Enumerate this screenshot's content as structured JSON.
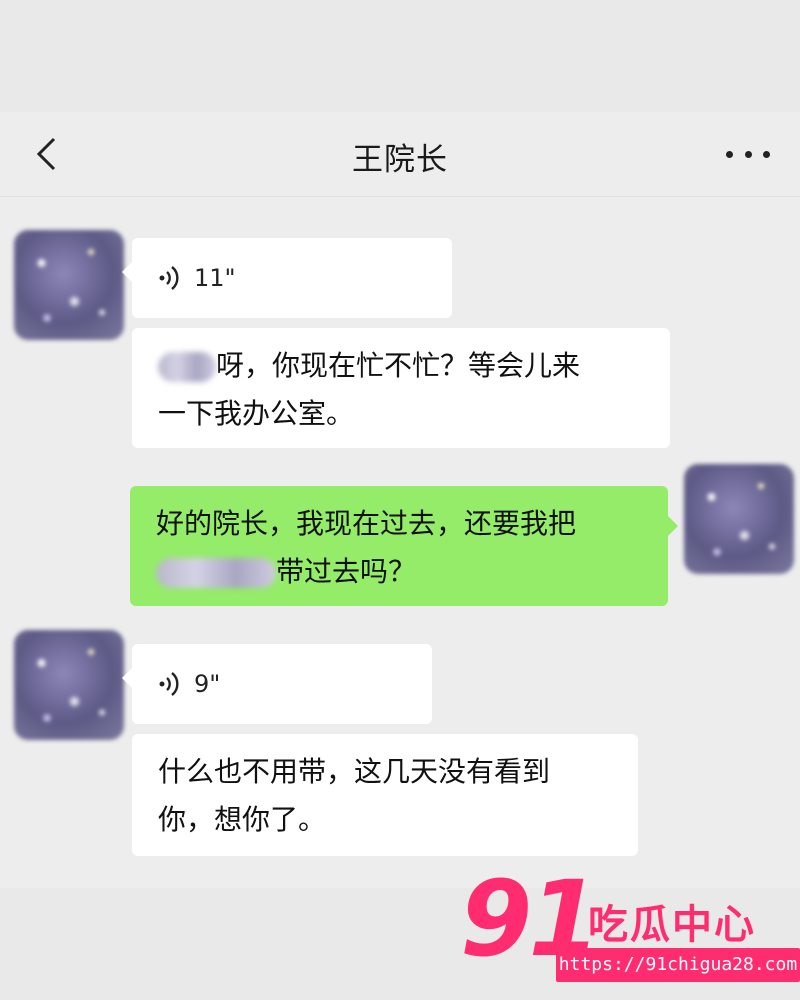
{
  "header": {
    "title": "王院长",
    "back_icon": "chevron-left-icon",
    "more_icon": "ellipsis-icon"
  },
  "messages": [
    {
      "side": "in",
      "type": "voice",
      "duration": "11\""
    },
    {
      "side": "in",
      "type": "text",
      "line1_visible": "呀，你现在忙不忙？等会儿来",
      "line2": "一下我办公室。"
    },
    {
      "side": "out",
      "type": "text",
      "line1": "好的院长，我现在过去，还要我把",
      "line2_visible": "带过去吗？"
    },
    {
      "side": "in",
      "type": "voice",
      "duration": "9\""
    },
    {
      "side": "in",
      "type": "text",
      "line1": "什么也不用带，这几天没有看到",
      "line2": "你，想你了。"
    }
  ],
  "watermark": {
    "number": "91",
    "name": "吃瓜中心",
    "url": "https://91chigua28.com"
  },
  "colors": {
    "outgoing_bubble": "#95ec69",
    "incoming_bubble": "#ffffff",
    "watermark": "#ff2d6f"
  }
}
